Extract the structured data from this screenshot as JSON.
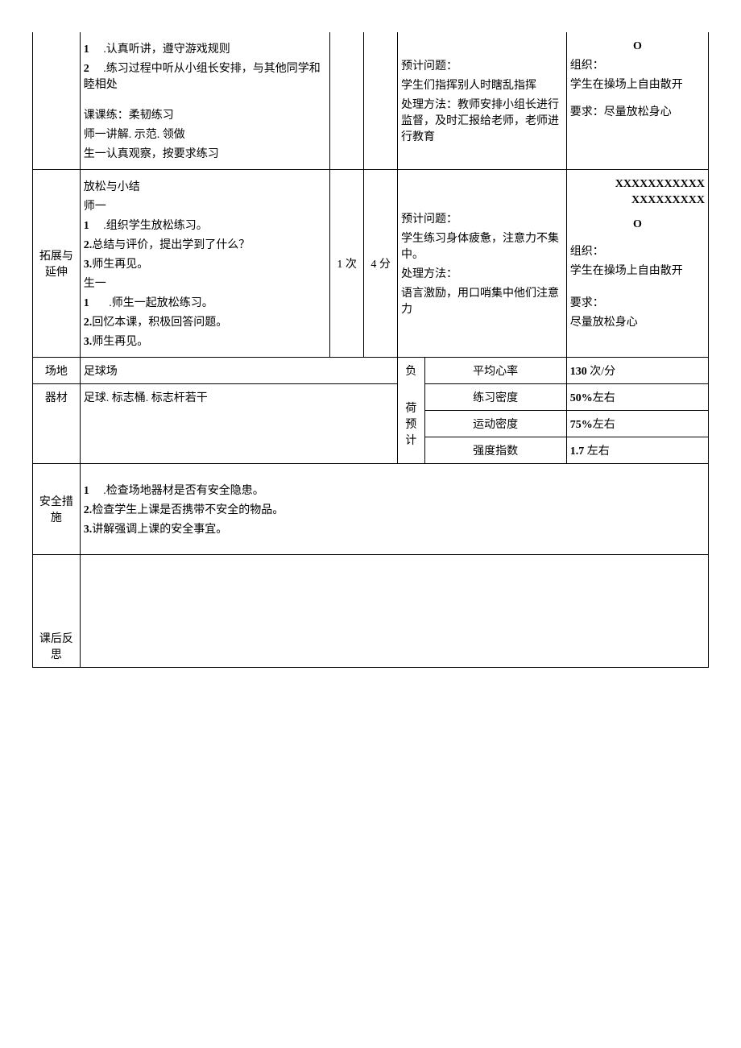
{
  "row1": {
    "col1": {
      "l1_num": "1",
      "l1_txt": ".认真听讲，遵守游戏规则",
      "l2_num": "2",
      "l2_txt": ".练习过程中听从小组长安排，与其他同学和睦相处",
      "l3": "课课练：柔韧练习",
      "l4": "师一讲解. 示范. 领做",
      "l5": "生一认真观察，按要求练习"
    },
    "col4": {
      "l1": "预计问题：",
      "l2": "学生们指挥别人时瞎乱指挥",
      "l3": "处理方法：教师安排小组长进行监督，及时汇报给老师，老师进行教育"
    },
    "col5": {
      "l0": "O",
      "l1": "组织：",
      "l2": "学生在操场上自由散开",
      "l3": "要求：尽量放松身心"
    }
  },
  "row2": {
    "label": "拓展与延伸",
    "col1": {
      "l1": "放松与小结",
      "l2": "师一",
      "l3_num": "1",
      "l3_txt": ".组织学生放松练习。",
      "l4_num": "2.",
      "l4_txt": "总结与评价，提出学到了什么？",
      "l5_num": "3.",
      "l5_txt": "师生再见。",
      "l6": "生一",
      "l7_num": "1",
      "l7_txt": ".师生一起放松练习。",
      "l8_num": "2.",
      "l8_txt": "回忆本课，积极回答问题。",
      "l9_num": "3.",
      "l9_txt": "师生再见。"
    },
    "col2": "1 次",
    "col3": "4 分",
    "col4": {
      "l1": "预计问题：",
      "l2": "学生练习身体疲惫，注意力不集中。",
      "l3": "处理方法：",
      "l4": "语言激励，用口哨集中他们注意力"
    },
    "col5": {
      "x1": "XXXXXXXXXXX",
      "x2": "XXXXXXXXX",
      "o": "O",
      "l1": "组织：",
      "l2": "学生在操场上自由散开",
      "l3": "要求：",
      "l4": "尽量放松身心"
    }
  },
  "row3": {
    "label1": "场地",
    "val1": "足球场",
    "label2": "器材",
    "val2": "足球. 标志桶. 标志杆若干",
    "fu": "负",
    "he": "荷 预计",
    "metrics": {
      "m1_label": "平均心率",
      "m1_val": "130 次/分",
      "m2_label": "练习密度",
      "m2_val": "50%左右",
      "m3_label": "运动密度",
      "m3_val": "75%左右",
      "m4_label": "强度指数",
      "m4_val": "1.7 左右"
    }
  },
  "row4": {
    "label": "安全措施",
    "l1_num": "1",
    "l1_txt": ".检查场地器材是否有安全隐患。",
    "l2_num": "2.",
    "l2_txt": "检查学生上课是否携带不安全的物品。",
    "l3_num": "3.",
    "l3_txt": "讲解强调上课的安全事宜。"
  },
  "row5": {
    "label": "课后反思"
  }
}
